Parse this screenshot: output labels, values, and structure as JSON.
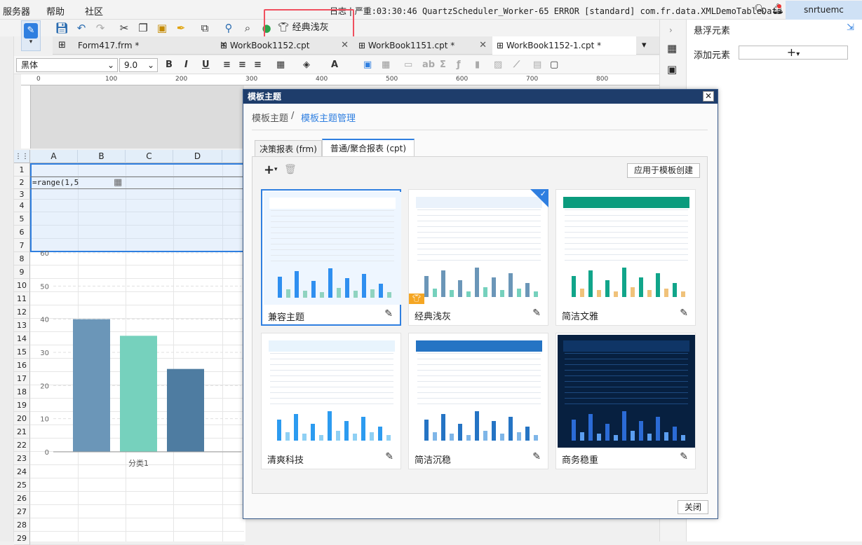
{
  "menu": {
    "items": [
      "服务器",
      "帮助",
      "社区"
    ]
  },
  "log": {
    "label": "日志",
    "message": "严重:03:30:46 QuartzScheduler_Worker-65 ERROR [standard] com.fr.data.XMLDemoTableData"
  },
  "user": {
    "name": "snrtuemc"
  },
  "toolbar": {
    "theme_button_label": "经典浅灰"
  },
  "tabs": [
    {
      "label": "Form417.frm *"
    },
    {
      "label": "WorkBook1152.cpt"
    },
    {
      "label": "WorkBook1151.cpt *"
    },
    {
      "label": "WorkBook1152-1.cpt *"
    }
  ],
  "format": {
    "font_family": "黑体",
    "font_size": "9.0",
    "bold": "B",
    "italic": "I",
    "underline": "U"
  },
  "ruler": {
    "ticks": [
      "0",
      "100",
      "200",
      "300",
      "400",
      "500",
      "600",
      "700",
      "800"
    ]
  },
  "sheet": {
    "columns": [
      "A",
      "B",
      "C",
      "D"
    ],
    "rows": [
      "1",
      "2",
      "3",
      "4",
      "5",
      "6",
      "7",
      "8",
      "9",
      "10",
      "11",
      "12",
      "13",
      "14",
      "15",
      "16",
      "17",
      "18",
      "19",
      "20",
      "21",
      "22",
      "23",
      "24",
      "25",
      "26",
      "27",
      "28",
      "29"
    ],
    "cell_a2": "=range(1,5"
  },
  "chart_data": {
    "type": "bar",
    "categories": [
      "分类1"
    ],
    "series": [
      {
        "values": [
          40
        ],
        "color": "#6b96b8"
      },
      {
        "values": [
          35
        ],
        "color": "#76d1bd"
      },
      {
        "values": [
          25
        ],
        "color": "#4e7ca1"
      }
    ],
    "yticks": [
      "0",
      "10",
      "20",
      "30",
      "40",
      "50",
      "60"
    ],
    "ylim": [
      0,
      60
    ],
    "grid": true
  },
  "dialog": {
    "title": "模板主题",
    "breadcrumb_root": "模板主题",
    "breadcrumb_sep": "/",
    "breadcrumb_current": "模板主题管理",
    "tabs": [
      "决策报表 (frm)",
      "普通/聚合报表 (cpt)"
    ],
    "apply_button": "应用于模板创建",
    "close_button": "关闭",
    "themes": [
      {
        "name": "兼容主题",
        "style": "compat"
      },
      {
        "name": "经典浅灰",
        "style": "light",
        "selected": true,
        "badge": true
      },
      {
        "name": "简洁文雅",
        "style": "teal"
      },
      {
        "name": "清爽科技",
        "style": "tech"
      },
      {
        "name": "简洁沉稳",
        "style": "steady"
      },
      {
        "name": "商务稳重",
        "style": "dark"
      }
    ]
  },
  "right_panel": {
    "title": "悬浮元素",
    "add_label": "添加元素",
    "add_button": "+"
  }
}
